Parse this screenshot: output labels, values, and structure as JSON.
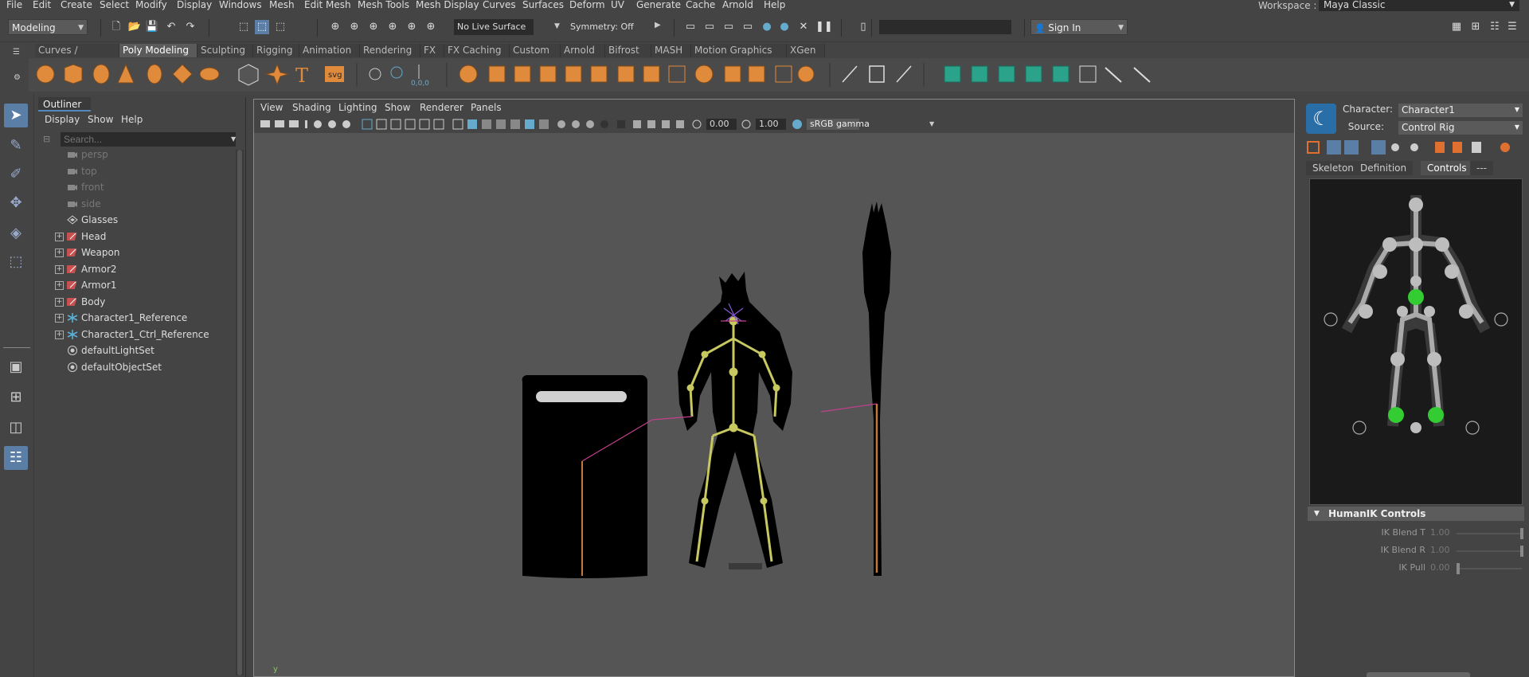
{
  "menubar": {
    "items": [
      "File",
      "Edit",
      "Create",
      "Select",
      "Modify",
      "Display",
      "Windows",
      "Mesh",
      "Edit Mesh",
      "Mesh Tools",
      "Mesh Display",
      "Curves",
      "Surfaces",
      "Deform",
      "UV",
      "Generate",
      "Cache",
      "Arnold",
      "Help"
    ],
    "workspace_label": "Workspace :",
    "workspace_value": "Maya Classic"
  },
  "statusline": {
    "mode": "Modeling",
    "live_surface": "No Live Surface",
    "symmetry": "Symmetry: Off",
    "sign_in": "Sign In"
  },
  "shelf": {
    "tabs": [
      "Curves / Surfaces",
      "Poly Modeling",
      "Sculpting",
      "Rigging",
      "Animation",
      "Rendering",
      "FX",
      "FX Caching",
      "Custom",
      "Arnold",
      "Bifrost",
      "MASH",
      "Motion Graphics",
      "XGen"
    ],
    "active_tab": "Poly Modeling",
    "svg_label": "svg",
    "coord_label": "0,0,0"
  },
  "outliner": {
    "title": "Outliner",
    "menus": [
      "Display",
      "Show",
      "Help"
    ],
    "search_placeholder": "Search...",
    "items": [
      {
        "label": "persp",
        "kind": "camera",
        "dim": true,
        "expand": false
      },
      {
        "label": "top",
        "kind": "camera",
        "dim": true,
        "expand": false
      },
      {
        "label": "front",
        "kind": "camera",
        "dim": true,
        "expand": false
      },
      {
        "label": "side",
        "kind": "camera",
        "dim": true,
        "expand": false
      },
      {
        "label": "Glasses",
        "kind": "mesh",
        "dim": false,
        "expand": false
      },
      {
        "label": "Head",
        "kind": "group",
        "dim": false,
        "expand": true
      },
      {
        "label": "Weapon",
        "kind": "group",
        "dim": false,
        "expand": true
      },
      {
        "label": "Armor2",
        "kind": "group",
        "dim": false,
        "expand": true
      },
      {
        "label": "Armor1",
        "kind": "group",
        "dim": false,
        "expand": true
      },
      {
        "label": "Body",
        "kind": "group",
        "dim": false,
        "expand": true
      },
      {
        "label": "Character1_Reference",
        "kind": "joint",
        "dim": false,
        "expand": true
      },
      {
        "label": "Character1_Ctrl_Reference",
        "kind": "joint",
        "dim": false,
        "expand": true
      },
      {
        "label": "defaultLightSet",
        "kind": "set",
        "dim": false,
        "expand": false
      },
      {
        "label": "defaultObjectSet",
        "kind": "set",
        "dim": false,
        "expand": false
      }
    ]
  },
  "viewport": {
    "menus": [
      "View",
      "Shading",
      "Lighting",
      "Show",
      "Renderer",
      "Panels"
    ],
    "exposure": "0.00",
    "gamma": "1.00",
    "color_space": "sRGB gamma",
    "axis_label": "y"
  },
  "hik": {
    "character_label": "Character:",
    "character_value": "Character1",
    "source_label": "Source:",
    "source_value": "Control Rig",
    "tabs": [
      "Skeleton",
      "Definition",
      "Controls",
      "---"
    ],
    "active_tab": "Controls",
    "section_title": "HumanIK Controls",
    "rows": [
      {
        "label": "IK Blend T",
        "value": "1.00",
        "level": 1.0
      },
      {
        "label": "IK Blend R",
        "value": "1.00",
        "level": 1.0
      },
      {
        "label": "IK Pull",
        "value": "0.00",
        "level": 0.0
      }
    ]
  },
  "colors": {
    "accent": "#5a7ea6",
    "shelf_icon": "#e08a3c",
    "skeleton": "#c8c860",
    "hik_green": "#33cc33"
  }
}
